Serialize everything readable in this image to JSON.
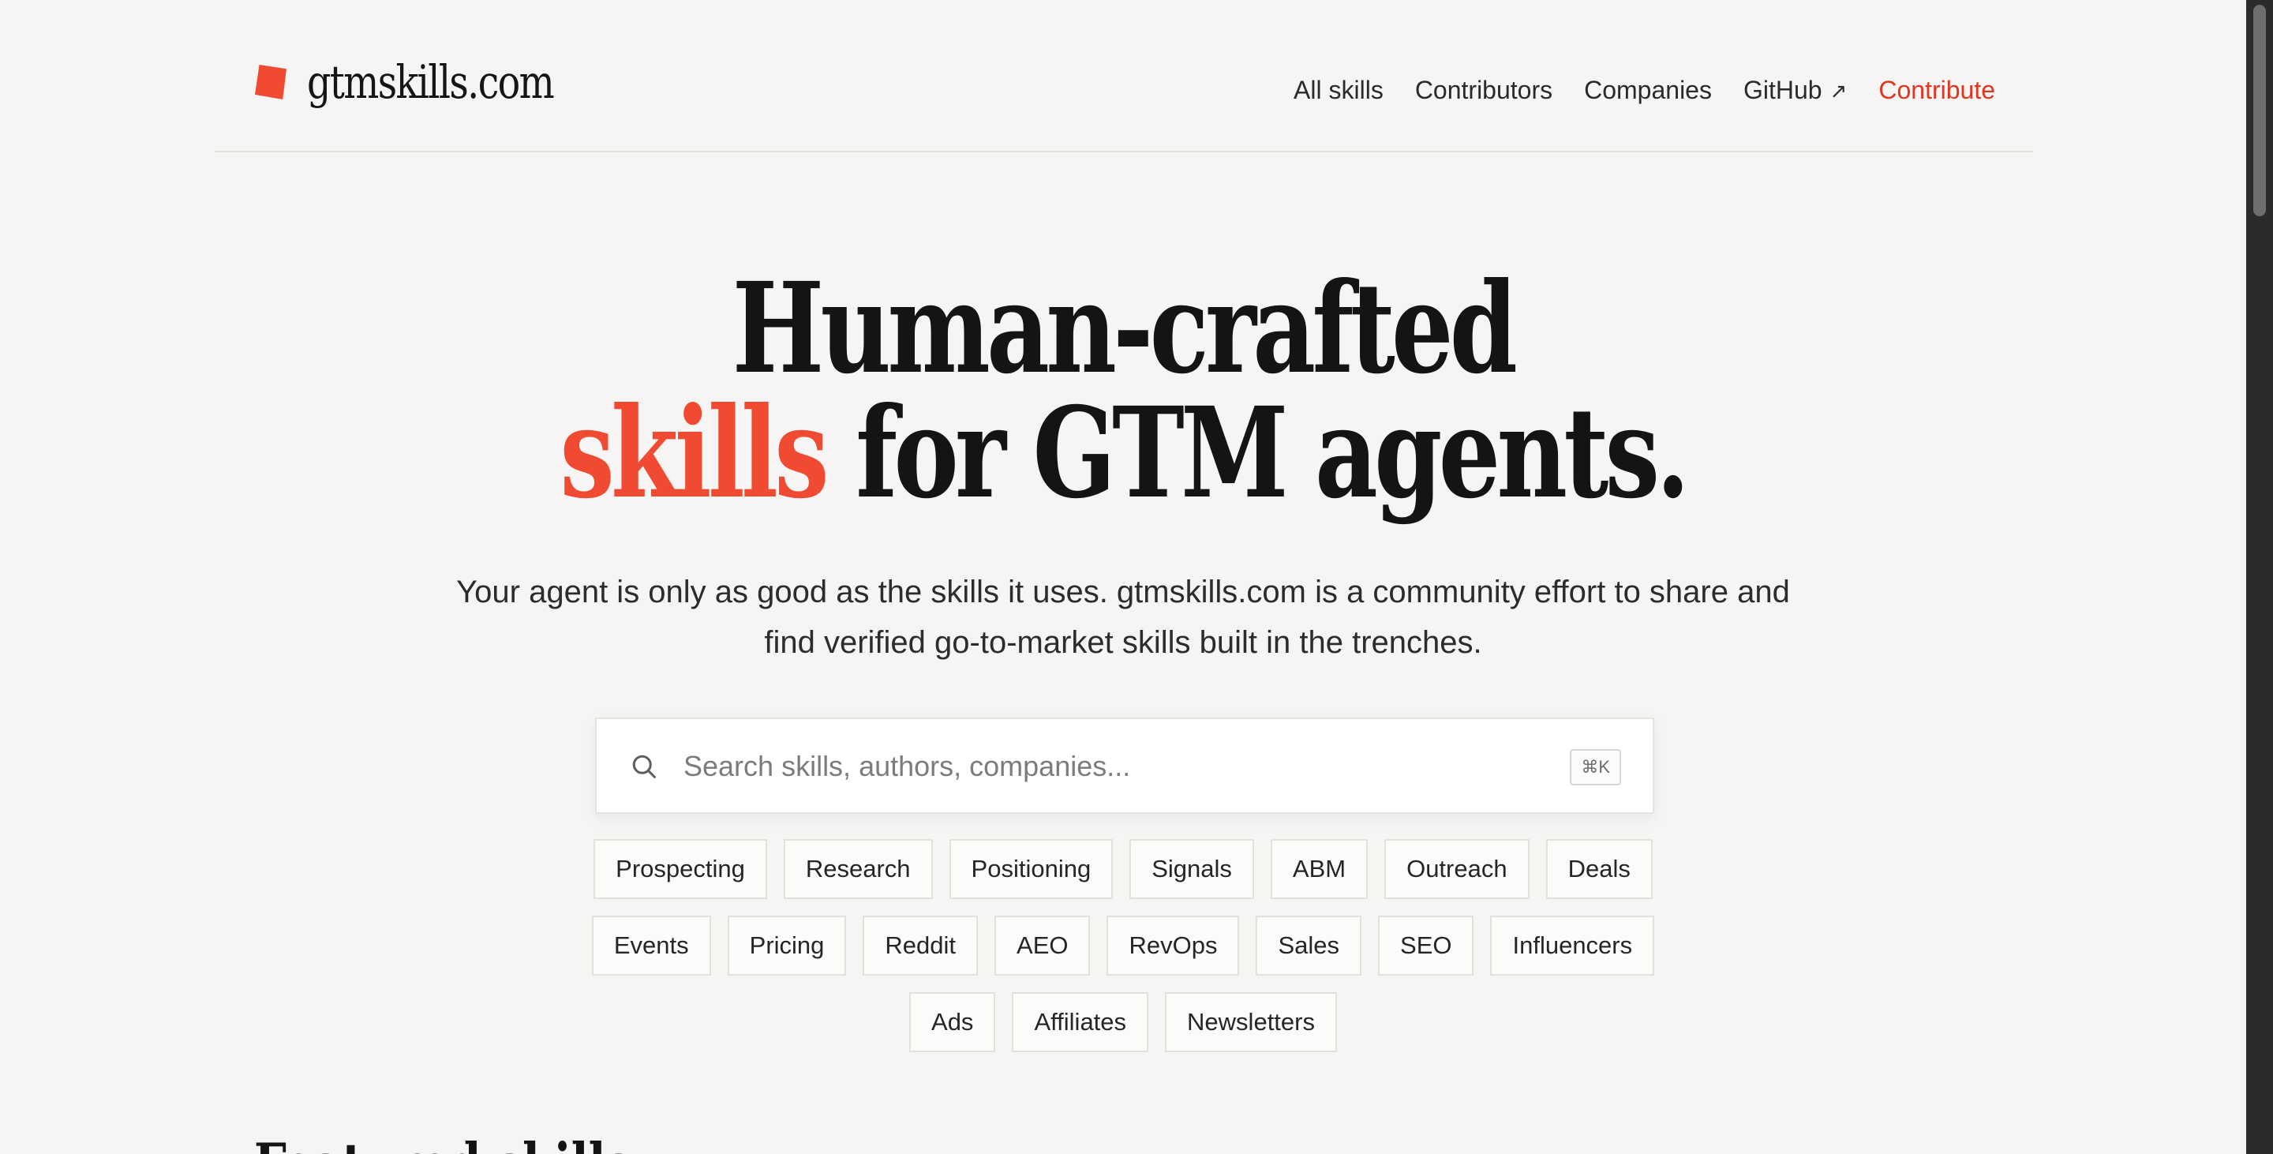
{
  "header": {
    "logo_text": "gtmskills.com",
    "nav": [
      {
        "label": "All skills"
      },
      {
        "label": "Contributors"
      },
      {
        "label": "Companies"
      },
      {
        "label": "GitHub",
        "icon": "arrow-up-right-icon"
      },
      {
        "label": "Contribute"
      }
    ]
  },
  "hero": {
    "title_line1": "Human-crafted",
    "title_accent": "skills",
    "title_line2_rest": " for GTM agents.",
    "subtitle_line1": "Your agent is only as good as the skills it uses. gtmskills.com is a community effort to share and",
    "subtitle_line2": "find verified go-to-market skills built in the trenches."
  },
  "search": {
    "placeholder": "Search skills, authors, companies...",
    "value": "",
    "shortcut": "⌘K"
  },
  "tags": {
    "row1": [
      "Prospecting",
      "Research",
      "Positioning",
      "Signals",
      "ABM",
      "Outreach",
      "Deals"
    ],
    "row2": [
      "Events",
      "Pricing",
      "Reddit",
      "AEO",
      "RevOps",
      "Sales",
      "SEO",
      "Influencers"
    ],
    "row3": [
      "Ads",
      "Affiliates",
      "Newsletters"
    ]
  },
  "next_section": {
    "title": "Featured skills"
  },
  "colors": {
    "accent": "#f04a32",
    "background": "#f6f5f3",
    "text": "#141414"
  }
}
